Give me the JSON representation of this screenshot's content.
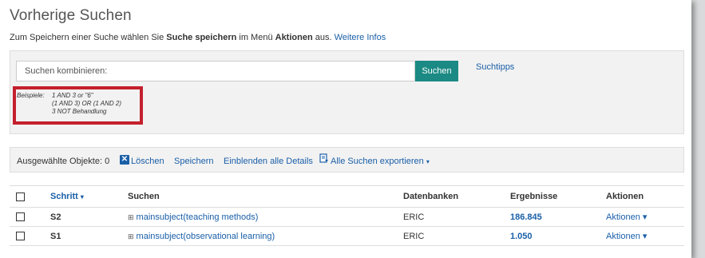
{
  "page": {
    "title": "Vorherige Suchen",
    "hint_prefix": "Zum Speichern einer Suche wählen Sie ",
    "hint_bold1": "Suche speichern",
    "hint_middle": " im Menü ",
    "hint_bold2": "Aktionen",
    "hint_suffix": " aus. ",
    "hint_link": "Weitere Infos"
  },
  "combine": {
    "placeholder": "Suchen kombinieren:",
    "search_button": "Suchen",
    "tips_link": "Suchtipps",
    "examples_label": "Beispiele:",
    "examples": [
      "1 AND 3 or \"6\"",
      "(1 AND 3) OR (1 AND 2)",
      "3 NOT Behandlung"
    ],
    "highlight_color": "#c4202d"
  },
  "selection": {
    "count_label": "Ausgewählte Objekte: 0",
    "delete": "Löschen",
    "save": "Speichern",
    "details": "Einblenden alle Details",
    "export": "Alle Suchen exportieren",
    "export_caret": "▾"
  },
  "table": {
    "headers": {
      "step": "Schritt",
      "step_caret": "▾",
      "search": "Suchen",
      "databases": "Datenbanken",
      "results": "Ergebnisse",
      "actions": "Aktionen"
    },
    "rows": [
      {
        "step": "S2",
        "search": "mainsubject(teaching methods)",
        "database": "ERIC",
        "results": "186.845",
        "actions": "Aktionen ▾"
      },
      {
        "step": "S1",
        "search": "mainsubject(observational learning)",
        "database": "ERIC",
        "results": "1.050",
        "actions": "Aktionen ▾"
      }
    ]
  },
  "colors": {
    "accent": "#1b8a84",
    "link": "#1a5fa8"
  }
}
